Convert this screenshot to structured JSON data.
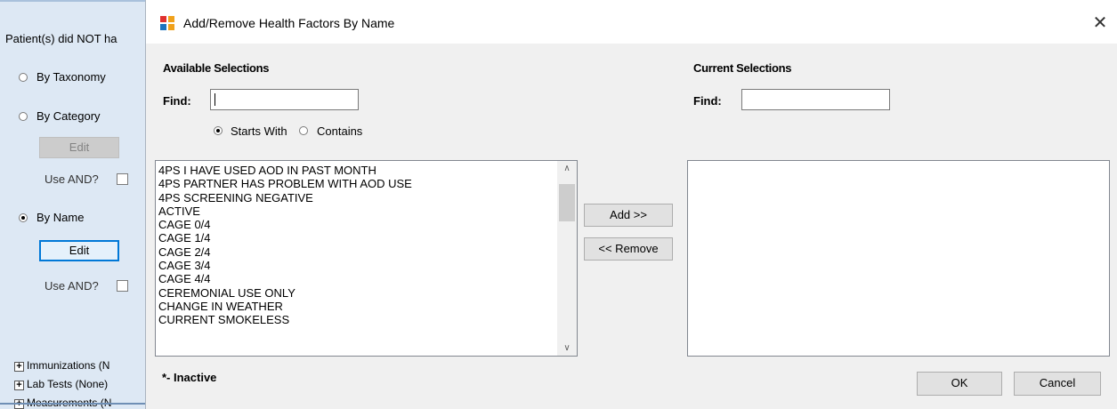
{
  "background_window": {
    "header_text": "Patient(s) did NOT ha",
    "radio_by_taxonomy": "By Taxonomy",
    "radio_by_category": "By Category",
    "category_edit_button": "Edit",
    "category_use_and": "Use AND?",
    "radio_by_name": "By Name",
    "name_edit_button": "Edit",
    "name_use_and": "Use AND?",
    "tree_items": [
      "Immunizations (N",
      "Lab Tests (None)",
      "Measurements (N"
    ],
    "selected_radio": "By Name"
  },
  "dialog": {
    "title": "Add/Remove Health Factors By Name",
    "close_glyph": "✕",
    "available": {
      "heading": "Available Selections",
      "find_label": "Find:",
      "find_value": "",
      "match_mode_starts_with": "Starts With",
      "match_mode_contains": "Contains",
      "selected_match_mode": "Starts With",
      "items": [
        "4PS I HAVE USED AOD IN PAST MONTH",
        "4PS PARTNER HAS PROBLEM WITH AOD USE",
        "4PS SCREENING NEGATIVE",
        "ACTIVE",
        "CAGE 0/4",
        "CAGE 1/4",
        "CAGE 2/4",
        "CAGE 3/4",
        "CAGE 4/4",
        "CEREMONIAL USE ONLY",
        "CHANGE IN WEATHER",
        "CURRENT SMOKELESS"
      ],
      "scroll_up_glyph": "∧",
      "scroll_down_glyph": "∨"
    },
    "add_button": "Add >>",
    "remove_button": "<< Remove",
    "current": {
      "heading": "Current Selections",
      "find_label": "Find:",
      "find_value": "",
      "items": []
    },
    "inactive_legend": "*- Inactive",
    "ok_button": "OK",
    "cancel_button": "Cancel"
  }
}
